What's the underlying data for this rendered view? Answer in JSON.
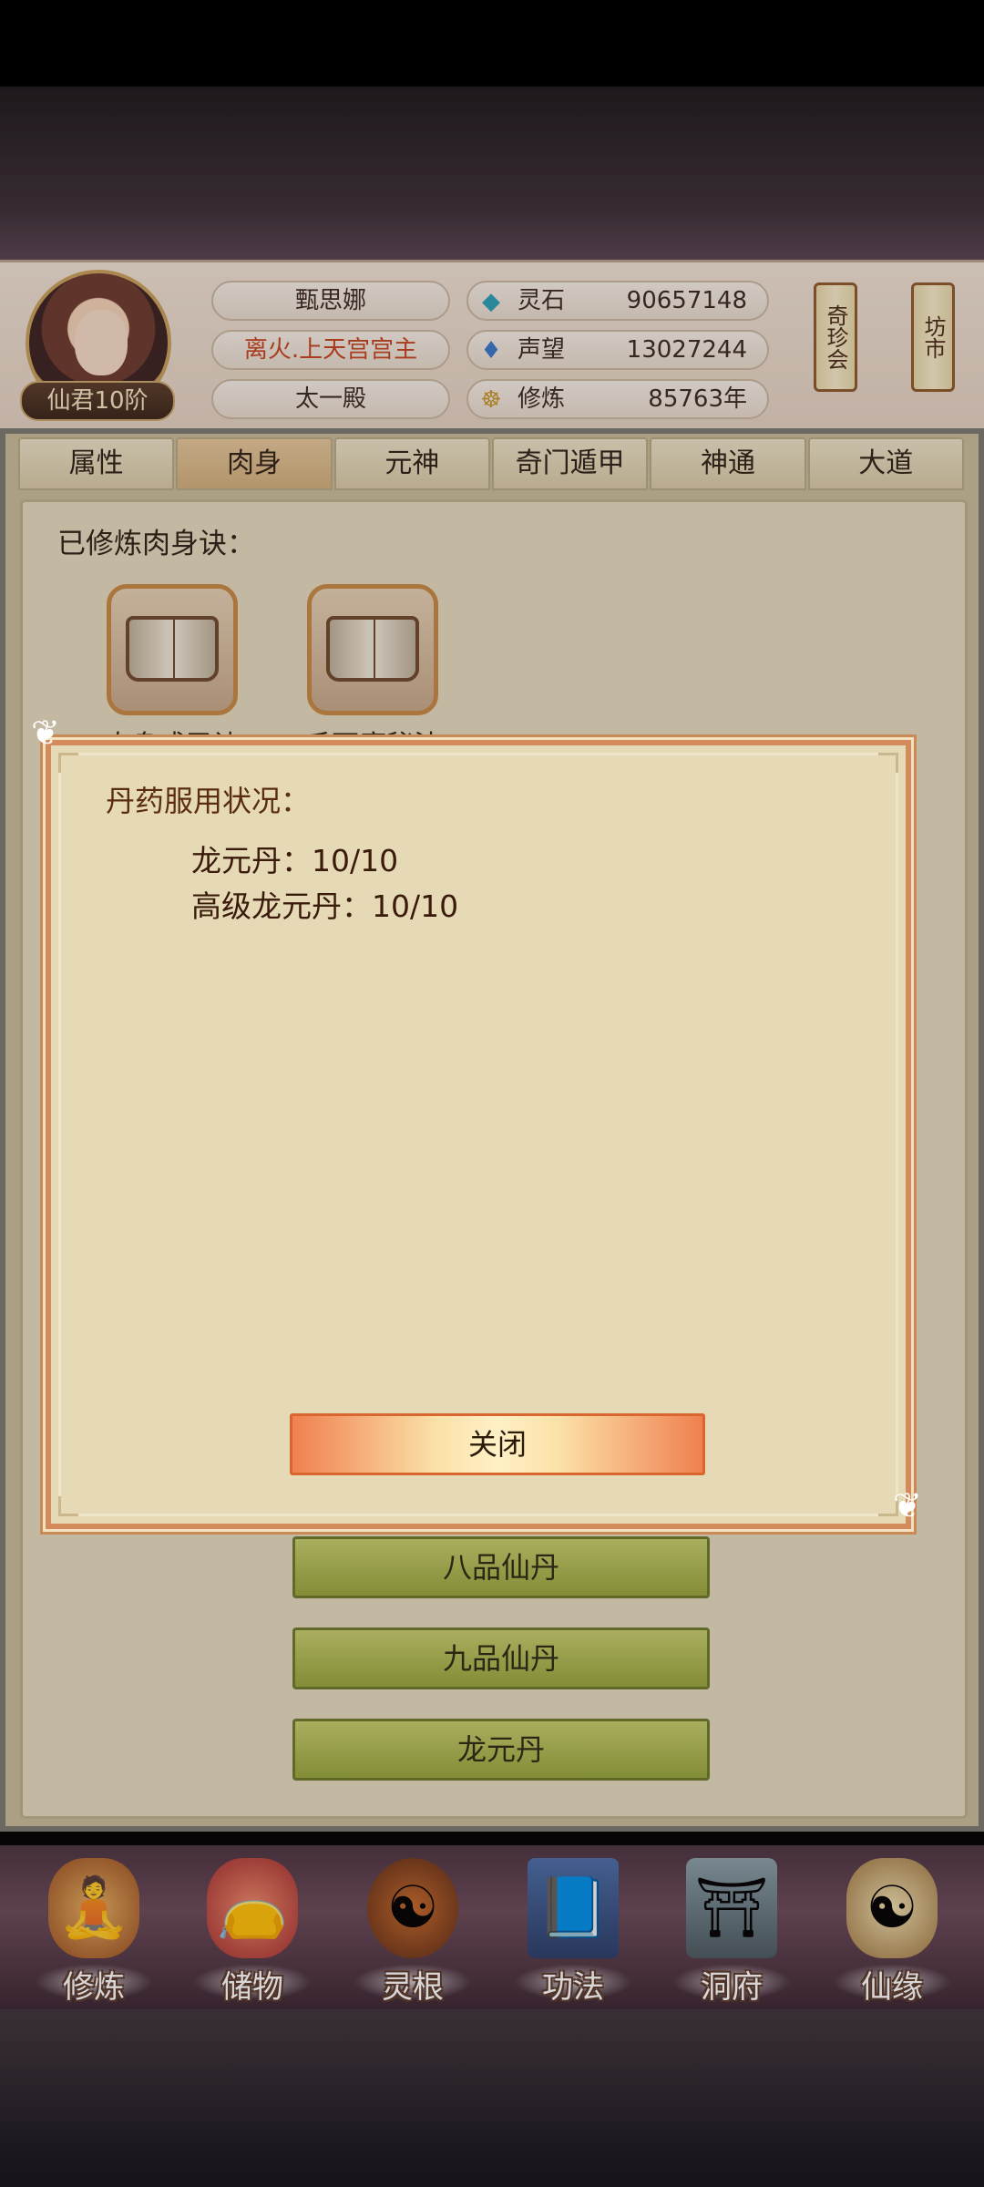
{
  "header": {
    "player_name": "甄思娜",
    "player_title": "离火.上天宫宫主",
    "palace": "太一殿",
    "rank": "仙君10阶",
    "resources": [
      {
        "icon": "spirit-stone-icon",
        "label": "灵石",
        "value": "90657148"
      },
      {
        "icon": "prestige-icon",
        "label": "声望",
        "value": "13027244"
      },
      {
        "icon": "cultivation-icon",
        "label": "修炼",
        "value": "85763年"
      }
    ],
    "shop_buttons": [
      "奇珍会",
      "坊市"
    ]
  },
  "tabs": [
    "属性",
    "肉身",
    "元神",
    "奇门遁甲",
    "神通",
    "大道"
  ],
  "active_tab": "肉身",
  "content": {
    "section_title": "已修炼肉身诀：",
    "books": [
      {
        "name": "肉身成圣诀"
      },
      {
        "name": "千面魔秘法"
      }
    ],
    "pill_buttons": [
      "八品仙丹",
      "九品仙丹",
      "龙元丹"
    ]
  },
  "dialog": {
    "title": "丹药服用状况：",
    "lines": [
      "龙元丹：10/10",
      "高级龙元丹：10/10"
    ],
    "close_label": "关闭"
  },
  "bottom_nav": [
    {
      "label": "修炼",
      "icon": "cultivate-icon"
    },
    {
      "label": "储物",
      "icon": "storage-bag-icon"
    },
    {
      "label": "灵根",
      "icon": "spirit-root-icon"
    },
    {
      "label": "功法",
      "icon": "technique-book-icon"
    },
    {
      "label": "洞府",
      "icon": "cave-abode-icon"
    },
    {
      "label": "仙缘",
      "icon": "fate-icon"
    }
  ]
}
